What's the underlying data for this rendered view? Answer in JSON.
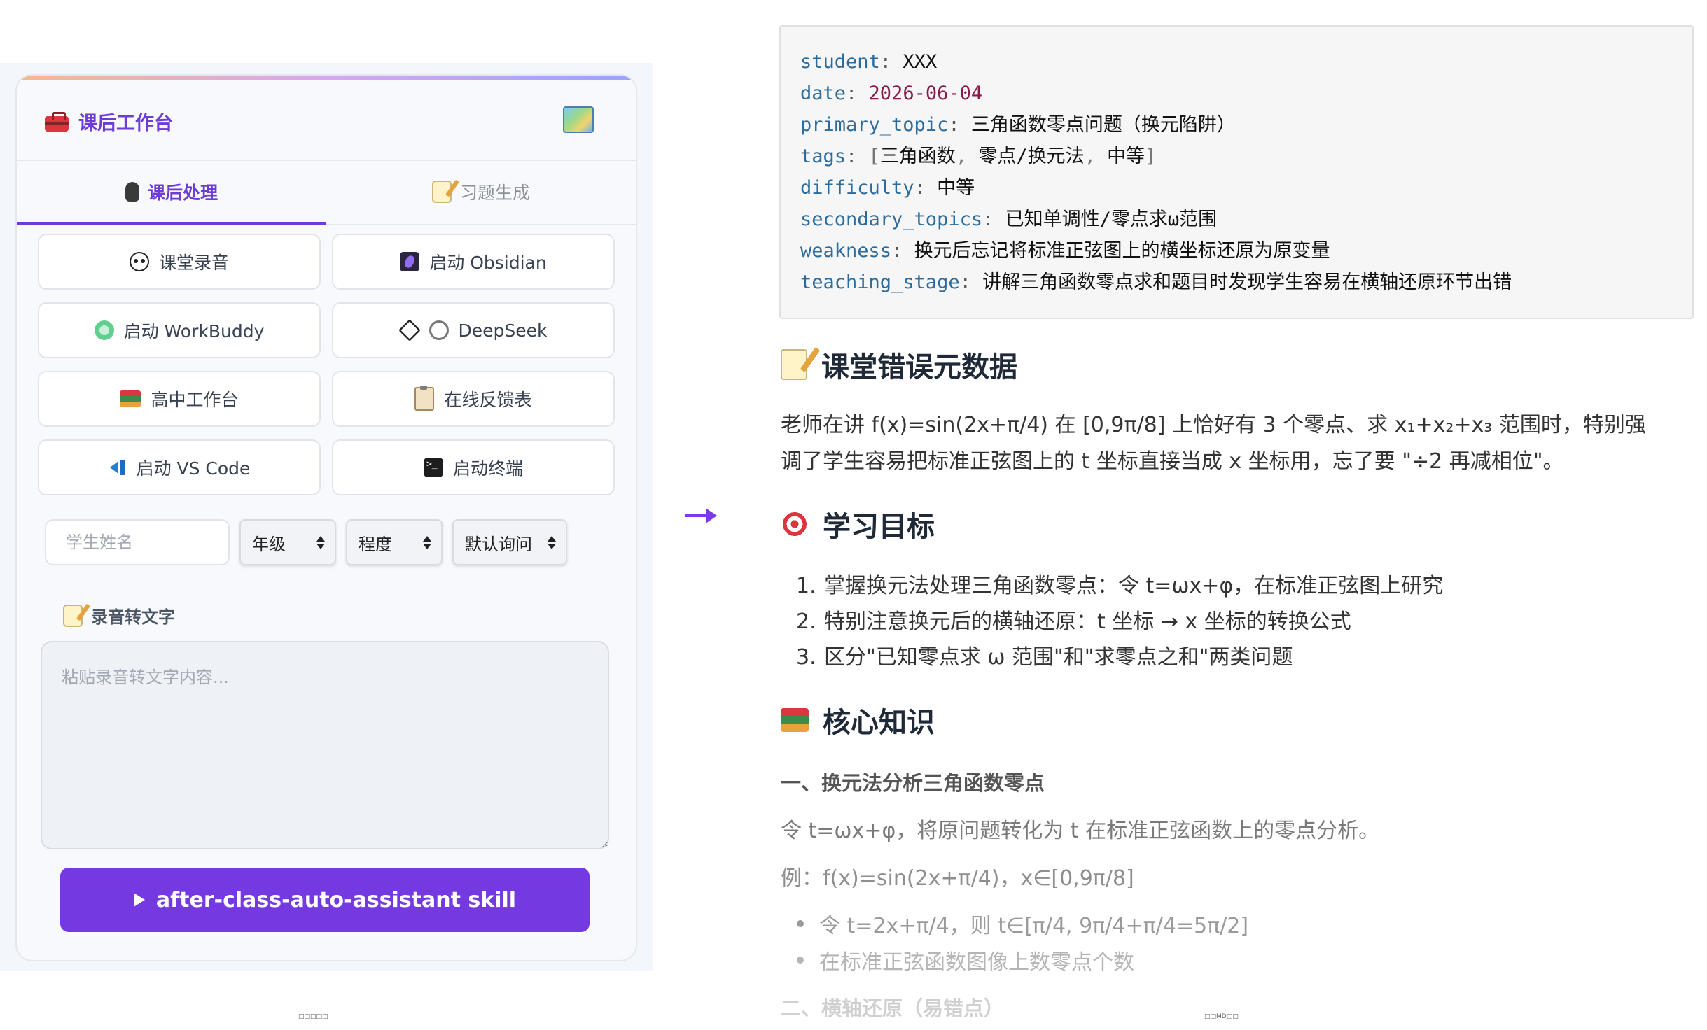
{
  "panel": {
    "title": "课后工作台",
    "tabs": [
      {
        "label": "课后处理",
        "active": true
      },
      {
        "label": "习题生成",
        "active": false
      }
    ],
    "buttons": [
      {
        "label": "课堂录音",
        "icon": "panda-icon"
      },
      {
        "label": "启动 Obsidian",
        "icon": "obsidian-icon"
      },
      {
        "label": "启动 WorkBuddy",
        "icon": "workbuddy-icon"
      },
      {
        "label": "DeepSeek",
        "icon": "link-icon"
      },
      {
        "label": "高中工作台",
        "icon": "books-icon"
      },
      {
        "label": "在线反馈表",
        "icon": "clipboard-icon"
      },
      {
        "label": "启动 VS Code",
        "icon": "vscode-icon"
      },
      {
        "label": "启动终端",
        "icon": "terminal-icon"
      }
    ],
    "form": {
      "name_placeholder": "学生姓名",
      "grade_select": "年级",
      "level_select": "程度",
      "query_select": "默认询问"
    },
    "transcript_label": "录音转文字",
    "transcript_placeholder": "粘贴录音转文字内容...",
    "run_button": "after-class-auto-assistant skill",
    "footer_label": "□□□□□",
    "accent_color": "#7439e0"
  },
  "document": {
    "frontmatter": {
      "student": "XXX",
      "date": "2026-06-04",
      "primary_topic": "三角函数零点问题（换元陷阱）",
      "tags": [
        "三角函数",
        "零点/换元法",
        "中等"
      ],
      "difficulty": "中等",
      "secondary_topics": "已知单调性/零点求ω范围",
      "weakness": "换元后忘记将标准正弦图上的横坐标还原为原变量",
      "teaching_stage": "讲解三角函数零点求和题目时发现学生容易在横轴还原环节出错"
    },
    "section_error": {
      "heading": "课堂错误元数据",
      "line1": "老师在讲 f(x)=sin(2x+π/4) 在 [0,9π/8] 上恰好有 3 个零点、求 x₁+x₂+x₃ 范围时，特别强",
      "line2": "调了学生容易把标准正弦图上的 t 坐标直接当成 x 坐标用，忘了要 \"÷2 再减相位\"。"
    },
    "section_goals": {
      "heading": "学习目标",
      "items": [
        "掌握换元法处理三角函数零点：令 t=ωx+φ，在标准正弦图上研究",
        "特别注意换元后的横轴还原：t 坐标 → x 坐标的转换公式",
        "区分\"已知零点求 ω 范围\"和\"求零点之和\"两类问题"
      ]
    },
    "section_core": {
      "heading": "核心知识",
      "subheading": "一、换元法分析三角函数零点",
      "para1": "令 t=ωx+φ，将原问题转化为 t 在标准正弦函数上的零点分析。",
      "para2": "例：f(x)=sin(2x+π/4)，x∈[0,9π/8]",
      "bullets": [
        "令 t=2x+π/4，则 t∈[π/4, 9π/4+π/4=5π/2]",
        "在标准正弦函数图像上数零点个数"
      ],
      "next_subheading": "二、横轴还原（易错点）"
    },
    "footer_label": "□□MD□□"
  }
}
